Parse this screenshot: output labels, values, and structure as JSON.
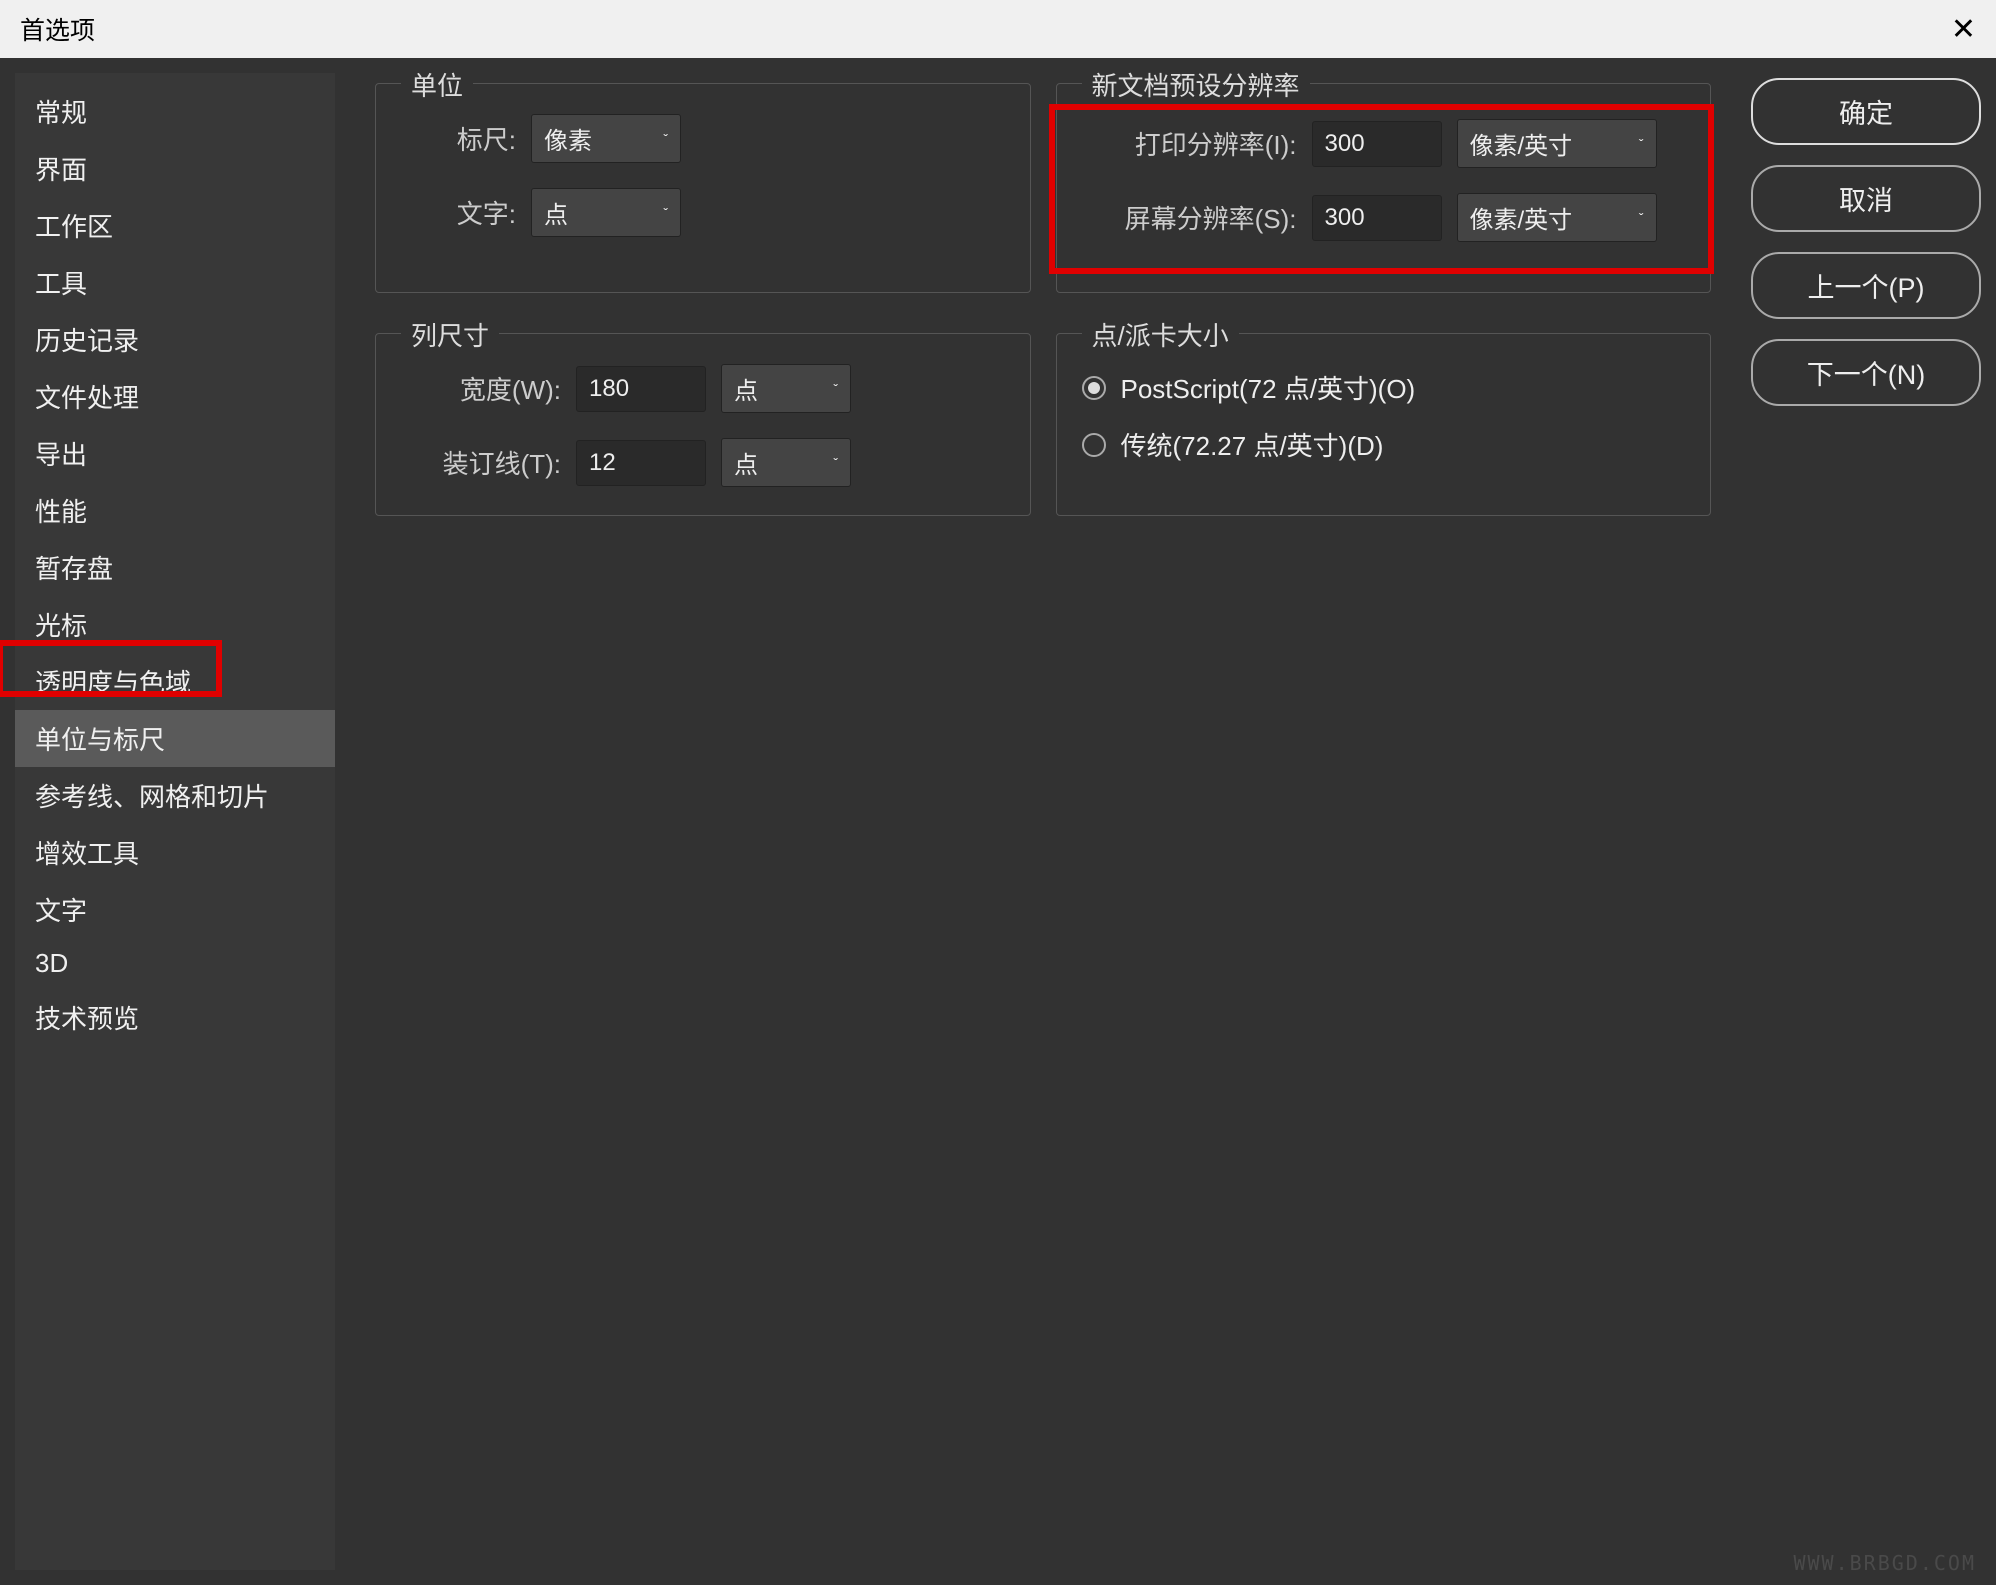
{
  "window": {
    "title": "首选项"
  },
  "sidebar": {
    "items": [
      "常规",
      "界面",
      "工作区",
      "工具",
      "历史记录",
      "文件处理",
      "导出",
      "性能",
      "暂存盘",
      "光标",
      "透明度与色域",
      "单位与标尺",
      "参考线、网格和切片",
      "增效工具",
      "文字",
      "3D",
      "技术预览"
    ],
    "active_index": 11
  },
  "units": {
    "legend": "单位",
    "ruler_label": "标尺:",
    "ruler_value": "像素",
    "type_label": "文字:",
    "type_value": "点"
  },
  "doc_resolution": {
    "legend": "新文档预设分辨率",
    "print_label": "打印分辨率(I):",
    "print_value": "300",
    "print_unit": "像素/英寸",
    "screen_label": "屏幕分辨率(S):",
    "screen_value": "300",
    "screen_unit": "像素/英寸"
  },
  "column_size": {
    "legend": "列尺寸",
    "width_label": "宽度(W):",
    "width_value": "180",
    "width_unit": "点",
    "gutter_label": "装订线(T):",
    "gutter_value": "12",
    "gutter_unit": "点"
  },
  "pica_size": {
    "legend": "点/派卡大小",
    "postscript_label": "PostScript(72 点/英寸)(O)",
    "traditional_label": "传统(72.27 点/英寸)(D)",
    "selected": "postscript"
  },
  "buttons": {
    "ok": "确定",
    "cancel": "取消",
    "prev": "上一个(P)",
    "next": "下一个(N)"
  },
  "watermark": "WWW.BRBGD.COM"
}
